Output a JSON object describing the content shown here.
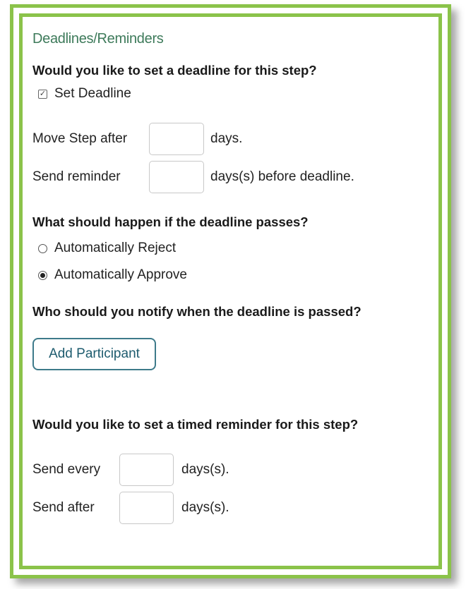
{
  "section_title": "Deadlines/Reminders",
  "deadline": {
    "question": "Would you like to set a deadline for this step?",
    "checkbox_label": "Set Deadline",
    "checkbox_checked": true,
    "move_step_label": "Move Step after",
    "move_step_value": "",
    "move_step_unit": "days.",
    "send_reminder_label": "Send reminder",
    "send_reminder_value": "",
    "send_reminder_unit": "days(s) before deadline."
  },
  "deadline_passes": {
    "question": "What should happen if the deadline passes?",
    "options": [
      {
        "label": "Automatically Reject",
        "selected": false
      },
      {
        "label": "Automatically Approve",
        "selected": true
      }
    ]
  },
  "notify": {
    "question": "Who should you notify when the deadline is passed?",
    "add_participant_label": "Add Participant"
  },
  "timed_reminder": {
    "question": "Would you like to set a timed reminder for this step?",
    "send_every_label": "Send every",
    "send_every_value": "",
    "send_every_unit": "days(s).",
    "send_after_label": "Send after",
    "send_after_value": "",
    "send_after_unit": "days(s)."
  },
  "colors": {
    "frame_green": "#8bc34a",
    "title_green": "#3d7a5a",
    "button_teal": "#1d5b6e"
  }
}
